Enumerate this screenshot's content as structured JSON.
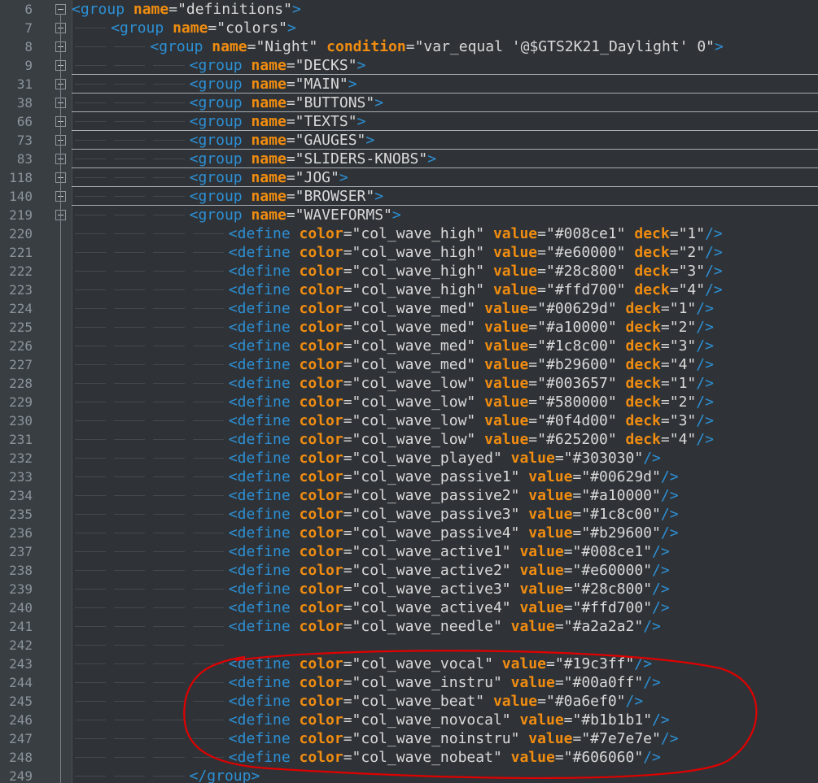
{
  "editor": {
    "lines": [
      {
        "num": "6",
        "indent": 0,
        "fold": "minus",
        "tag": "group",
        "attrs": [
          [
            "name",
            "\"definitions\""
          ]
        ],
        "close": ">"
      },
      {
        "num": "7",
        "indent": 1,
        "fold": "minus",
        "tag": "group",
        "attrs": [
          [
            "name",
            "\"colors\""
          ]
        ],
        "close": ">"
      },
      {
        "num": "8",
        "indent": 2,
        "fold": "minus",
        "tag": "group",
        "attrs": [
          [
            "name",
            "\"Night\""
          ],
          [
            "condition",
            "\"var_equal '@$GTS2K21_Daylight' 0\""
          ]
        ],
        "close": ">"
      },
      {
        "num": "9",
        "indent": 3,
        "fold": "plus",
        "tag": "group",
        "attrs": [
          [
            "name",
            "\"DECKS\""
          ]
        ],
        "close": ">"
      },
      {
        "num": "31",
        "indent": 3,
        "fold": "plus",
        "tag": "group",
        "attrs": [
          [
            "name",
            "\"MAIN\""
          ]
        ],
        "close": ">"
      },
      {
        "num": "38",
        "indent": 3,
        "fold": "plus",
        "tag": "group",
        "attrs": [
          [
            "name",
            "\"BUTTONS\""
          ]
        ],
        "close": ">"
      },
      {
        "num": "66",
        "indent": 3,
        "fold": "plus",
        "tag": "group",
        "attrs": [
          [
            "name",
            "\"TEXTS\""
          ]
        ],
        "close": ">"
      },
      {
        "num": "73",
        "indent": 3,
        "fold": "plus",
        "tag": "group",
        "attrs": [
          [
            "name",
            "\"GAUGES\""
          ]
        ],
        "close": ">"
      },
      {
        "num": "83",
        "indent": 3,
        "fold": "plus",
        "tag": "group",
        "attrs": [
          [
            "name",
            "\"SLIDERS-KNOBS\""
          ]
        ],
        "close": ">"
      },
      {
        "num": "118",
        "indent": 3,
        "fold": "plus",
        "tag": "group",
        "attrs": [
          [
            "name",
            "\"JOG\""
          ]
        ],
        "close": ">"
      },
      {
        "num": "140",
        "indent": 3,
        "fold": "plus",
        "tag": "group",
        "attrs": [
          [
            "name",
            "\"BROWSER\""
          ]
        ],
        "close": ">"
      },
      {
        "num": "219",
        "indent": 3,
        "fold": "minus",
        "tag": "group",
        "attrs": [
          [
            "name",
            "\"WAVEFORMS\""
          ]
        ],
        "close": ">"
      },
      {
        "num": "220",
        "indent": 4,
        "tag": "define",
        "attrs": [
          [
            "color",
            "\"col_wave_high\""
          ],
          [
            "value",
            "\"#008ce1\""
          ],
          [
            "deck",
            "\"1\""
          ]
        ],
        "close": "/>"
      },
      {
        "num": "221",
        "indent": 4,
        "tag": "define",
        "attrs": [
          [
            "color",
            "\"col_wave_high\""
          ],
          [
            "value",
            "\"#e60000\""
          ],
          [
            "deck",
            "\"2\""
          ]
        ],
        "close": "/>"
      },
      {
        "num": "222",
        "indent": 4,
        "tag": "define",
        "attrs": [
          [
            "color",
            "\"col_wave_high\""
          ],
          [
            "value",
            "\"#28c800\""
          ],
          [
            "deck",
            "\"3\""
          ]
        ],
        "close": "/>"
      },
      {
        "num": "223",
        "indent": 4,
        "tag": "define",
        "attrs": [
          [
            "color",
            "\"col_wave_high\""
          ],
          [
            "value",
            "\"#ffd700\""
          ],
          [
            "deck",
            "\"4\""
          ]
        ],
        "close": "/>"
      },
      {
        "num": "224",
        "indent": 4,
        "tag": "define",
        "attrs": [
          [
            "color",
            "\"col_wave_med\""
          ],
          [
            "value",
            "\"#00629d\""
          ],
          [
            "deck",
            "\"1\""
          ]
        ],
        "close": "/>"
      },
      {
        "num": "225",
        "indent": 4,
        "tag": "define",
        "attrs": [
          [
            "color",
            "\"col_wave_med\""
          ],
          [
            "value",
            "\"#a10000\""
          ],
          [
            "deck",
            "\"2\""
          ]
        ],
        "close": "/>"
      },
      {
        "num": "226",
        "indent": 4,
        "tag": "define",
        "attrs": [
          [
            "color",
            "\"col_wave_med\""
          ],
          [
            "value",
            "\"#1c8c00\""
          ],
          [
            "deck",
            "\"3\""
          ]
        ],
        "close": "/>"
      },
      {
        "num": "227",
        "indent": 4,
        "tag": "define",
        "attrs": [
          [
            "color",
            "\"col_wave_med\""
          ],
          [
            "value",
            "\"#b29600\""
          ],
          [
            "deck",
            "\"4\""
          ]
        ],
        "close": "/>"
      },
      {
        "num": "228",
        "indent": 4,
        "tag": "define",
        "attrs": [
          [
            "color",
            "\"col_wave_low\""
          ],
          [
            "value",
            "\"#003657\""
          ],
          [
            "deck",
            "\"1\""
          ]
        ],
        "close": "/>"
      },
      {
        "num": "229",
        "indent": 4,
        "tag": "define",
        "attrs": [
          [
            "color",
            "\"col_wave_low\""
          ],
          [
            "value",
            "\"#580000\""
          ],
          [
            "deck",
            "\"2\""
          ]
        ],
        "close": "/>"
      },
      {
        "num": "230",
        "indent": 4,
        "tag": "define",
        "attrs": [
          [
            "color",
            "\"col_wave_low\""
          ],
          [
            "value",
            "\"#0f4d00\""
          ],
          [
            "deck",
            "\"3\""
          ]
        ],
        "close": "/>"
      },
      {
        "num": "231",
        "indent": 4,
        "tag": "define",
        "attrs": [
          [
            "color",
            "\"col_wave_low\""
          ],
          [
            "value",
            "\"#625200\""
          ],
          [
            "deck",
            "\"4\""
          ]
        ],
        "close": "/>"
      },
      {
        "num": "232",
        "indent": 4,
        "tag": "define",
        "attrs": [
          [
            "color",
            "\"col_wave_played\""
          ],
          [
            "value",
            "\"#303030\""
          ]
        ],
        "close": "/>"
      },
      {
        "num": "233",
        "indent": 4,
        "tag": "define",
        "attrs": [
          [
            "color",
            "\"col_wave_passive1\""
          ],
          [
            "value",
            "\"#00629d\""
          ]
        ],
        "close": "/>"
      },
      {
        "num": "234",
        "indent": 4,
        "tag": "define",
        "attrs": [
          [
            "color",
            "\"col_wave_passive2\""
          ],
          [
            "value",
            "\"#a10000\""
          ]
        ],
        "close": "/>"
      },
      {
        "num": "235",
        "indent": 4,
        "tag": "define",
        "attrs": [
          [
            "color",
            "\"col_wave_passive3\""
          ],
          [
            "value",
            "\"#1c8c00\""
          ]
        ],
        "close": "/>"
      },
      {
        "num": "236",
        "indent": 4,
        "tag": "define",
        "attrs": [
          [
            "color",
            "\"col_wave_passive4\""
          ],
          [
            "value",
            "\"#b29600\""
          ]
        ],
        "close": "/>"
      },
      {
        "num": "237",
        "indent": 4,
        "tag": "define",
        "attrs": [
          [
            "color",
            "\"col_wave_active1\""
          ],
          [
            "value",
            "\"#008ce1\""
          ]
        ],
        "close": "/>"
      },
      {
        "num": "238",
        "indent": 4,
        "tag": "define",
        "attrs": [
          [
            "color",
            "\"col_wave_active2\""
          ],
          [
            "value",
            "\"#e60000\""
          ]
        ],
        "close": "/>"
      },
      {
        "num": "239",
        "indent": 4,
        "tag": "define",
        "attrs": [
          [
            "color",
            "\"col_wave_active3\""
          ],
          [
            "value",
            "\"#28c800\""
          ]
        ],
        "close": "/>"
      },
      {
        "num": "240",
        "indent": 4,
        "tag": "define",
        "attrs": [
          [
            "color",
            "\"col_wave_active4\""
          ],
          [
            "value",
            "\"#ffd700\""
          ]
        ],
        "close": "/>"
      },
      {
        "num": "241",
        "indent": 4,
        "tag": "define",
        "attrs": [
          [
            "color",
            "\"col_wave_needle\""
          ],
          [
            "value",
            "\"#a2a2a2\""
          ]
        ],
        "close": "/>"
      },
      {
        "num": "242",
        "indent": 4,
        "tag": "",
        "attrs": [],
        "close": ""
      },
      {
        "num": "243",
        "indent": 4,
        "tag": "define",
        "attrs": [
          [
            "color",
            "\"col_wave_vocal\""
          ],
          [
            "value",
            "\"#19c3ff\""
          ]
        ],
        "close": "/>"
      },
      {
        "num": "244",
        "indent": 4,
        "tag": "define",
        "attrs": [
          [
            "color",
            "\"col_wave_instru\""
          ],
          [
            "value",
            "\"#00a0ff\""
          ]
        ],
        "close": "/>"
      },
      {
        "num": "245",
        "indent": 4,
        "tag": "define",
        "attrs": [
          [
            "color",
            "\"col_wave_beat\""
          ],
          [
            "value",
            "\"#0a6ef0\""
          ]
        ],
        "close": "/>"
      },
      {
        "num": "246",
        "indent": 4,
        "tag": "define",
        "attrs": [
          [
            "color",
            "\"col_wave_novocal\""
          ],
          [
            "value",
            "\"#b1b1b1\""
          ]
        ],
        "close": "/>"
      },
      {
        "num": "247",
        "indent": 4,
        "tag": "define",
        "attrs": [
          [
            "color",
            "\"col_wave_noinstru\""
          ],
          [
            "value",
            "\"#7e7e7e\""
          ]
        ],
        "close": "/>"
      },
      {
        "num": "248",
        "indent": 4,
        "tag": "define",
        "attrs": [
          [
            "color",
            "\"col_wave_nobeat\""
          ],
          [
            "value",
            "\"#606060\""
          ]
        ],
        "close": "/>"
      },
      {
        "num": "249",
        "indent": 3,
        "tag": "/group",
        "attrs": [],
        "close": ">"
      }
    ]
  },
  "colors": {
    "background": "#2f3337",
    "gutter": "#393e43",
    "tag": "#2d8fd4",
    "attribute": "#f08c10",
    "value": "#d9d9d9",
    "annotation": "#e00000"
  }
}
